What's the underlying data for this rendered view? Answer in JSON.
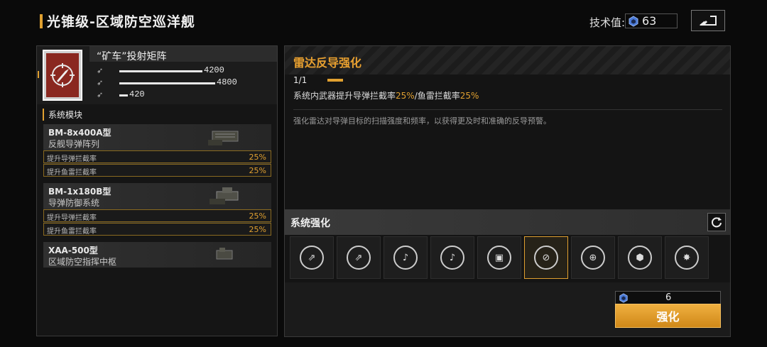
{
  "header": {
    "title": "光锥级-区域防空巡洋舰",
    "tech_label": "技术值:",
    "tech_value": "63"
  },
  "weapon": {
    "name": "“矿车”投射矩阵",
    "stats": [
      {
        "value": "4200",
        "fill": 0.78
      },
      {
        "value": "4800",
        "fill": 0.9
      },
      {
        "value": "420",
        "fill": 0.08
      }
    ]
  },
  "modules_section": {
    "title": "系统模块",
    "modules": [
      {
        "name": "BM-8x400A型",
        "sub": "反舰导弹阵列",
        "rows": [
          {
            "label": "提升导弹拦截率",
            "value": "25%"
          },
          {
            "label": "提升鱼雷拦截率",
            "value": "25%"
          }
        ]
      },
      {
        "name": "BM-1x180B型",
        "sub": "导弹防御系统",
        "rows": [
          {
            "label": "提升导弹拦截率",
            "value": "25%"
          },
          {
            "label": "提升鱼雷拦截率",
            "value": "25%"
          }
        ]
      },
      {
        "name": "XAA-500型",
        "sub": "区域防空指挥中枢",
        "rows": []
      }
    ]
  },
  "detail": {
    "title": "雷达反导强化",
    "level": "1/1",
    "effect_prefix": "系统内武器提升导弹拦截率",
    "effect_v1": "25%",
    "effect_mid": "/鱼雷拦截率",
    "effect_v2": "25%",
    "description": "强化雷达对导弹目标的扫描强度和频率，以获得更及时和准确的反导预警。"
  },
  "enhance": {
    "title": "系统强化",
    "slots": [
      "missile",
      "missile",
      "guitar",
      "guitar",
      "chip",
      "radar-crossed",
      "target",
      "cube",
      "star"
    ],
    "active_index": 5,
    "cost": "6",
    "button_label": "强化"
  },
  "colors": {
    "accent": "#e0a030",
    "bg": "#0a0a0a"
  }
}
